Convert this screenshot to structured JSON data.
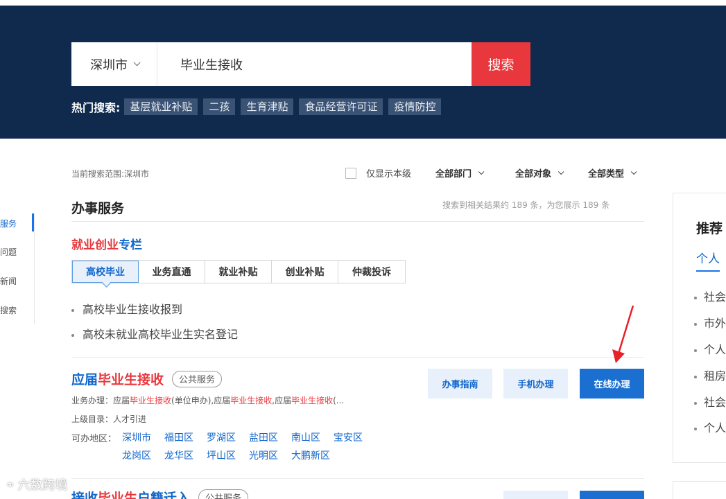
{
  "search": {
    "city": "深圳市",
    "query": "毕业生接收",
    "button": "搜索",
    "hot_label": "热门搜索:",
    "hot_tags": [
      "基层就业补贴",
      "二孩",
      "生育津贴",
      "食品经营许可证",
      "疫情防控"
    ]
  },
  "sidenav": {
    "items": [
      "服务",
      "问题",
      "新闻",
      "搜索"
    ]
  },
  "filters": {
    "scope_label": "当前搜索范围:深圳市",
    "only_level": "仅显示本级",
    "dept": "全部部门",
    "target": "全部对象",
    "type": "全部类型"
  },
  "section": {
    "title": "办事服务",
    "result_count": "搜索到相关结果约 189 条，为您展示 189 条"
  },
  "column": {
    "title_red": "就业创业",
    "title_blue": "专栏",
    "tabs": [
      "高校毕业",
      "业务直通",
      "就业补贴",
      "创业补贴",
      "仲裁投诉"
    ],
    "active_tab": 0,
    "items": [
      "高校毕业生接收报到",
      "高校未就业高校毕业生实名登记"
    ]
  },
  "result1": {
    "title_pre": "应届",
    "title_hl": "毕业生接收",
    "badge": "公共服务",
    "line1_label": "业务办理：",
    "line1_p1": "应届",
    "line1_h1": "毕业生接收",
    "line1_p2": "(单位申办),应届",
    "line1_h2": "毕业生接收",
    "line1_p3": ",应届",
    "line1_h3": "毕业生接收",
    "line1_p4": "(...",
    "line2": "上级目录：人才引进",
    "areas_label": "可办地区：",
    "areas": [
      "深圳市",
      "福田区",
      "罗湖区",
      "盐田区",
      "南山区",
      "宝安区",
      "龙岗区",
      "龙华区",
      "坪山区",
      "光明区",
      "大鹏新区"
    ],
    "btn_guide": "办事指南",
    "btn_mobile": "手机办理",
    "btn_online": "在线办理"
  },
  "result2": {
    "title_pre": "接收",
    "title_hl": "毕业生",
    "title_post": "户籍迁入",
    "badge": "公共服务"
  },
  "recommend": {
    "title": "推荐",
    "tab": "个人",
    "items": [
      "社会",
      "市外",
      "个人",
      "租房",
      "社会",
      "个人"
    ]
  },
  "watermark": "六数跨境",
  "colors": {
    "header_bg": "#0f2a4c",
    "accent_red": "#e8383d",
    "link_blue": "#1166cc",
    "primary_btn": "#1a6fd1"
  }
}
